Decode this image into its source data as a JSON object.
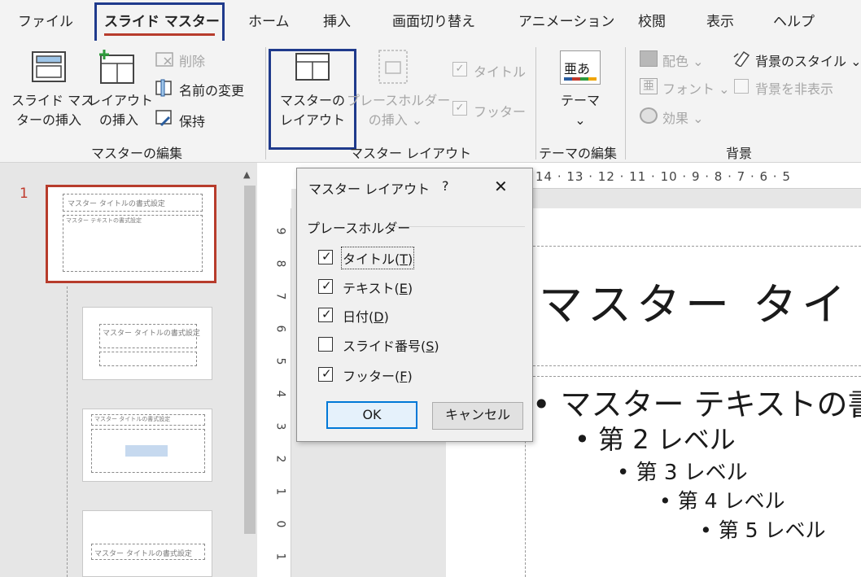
{
  "tabs": [
    {
      "label": "ファイル",
      "active": false
    },
    {
      "label": "スライド マスター",
      "active": true
    },
    {
      "label": "ホーム",
      "active": false
    },
    {
      "label": "挿入",
      "active": false
    },
    {
      "label": "画面切り替え",
      "active": false
    },
    {
      "label": "アニメーション",
      "active": false
    },
    {
      "label": "校閲",
      "active": false
    },
    {
      "label": "表示",
      "active": false
    },
    {
      "label": "ヘルプ",
      "active": false
    }
  ],
  "ribbon": {
    "edit_master": {
      "insert_master_line1": "スライド マス",
      "insert_master_line2": "ターの挿入",
      "insert_layout_line1": "レイアウト",
      "insert_layout_line2": "の挿入",
      "delete": "削除",
      "rename": "名前の変更",
      "preserve": "保持",
      "group_label": "マスターの編集"
    },
    "master_layout": {
      "master_layout_line1": "マスターの",
      "master_layout_line2": "レイアウト",
      "insert_placeholder_line1": "プレースホルダー",
      "insert_placeholder_line2": "の挿入",
      "title_check": "タイトル",
      "footer_check": "フッター",
      "group_label": "マスター レイアウト"
    },
    "edit_theme": {
      "theme": "テーマ",
      "theme_icon_text": "亜あ",
      "group_label": "テーマの編集"
    },
    "background": {
      "colors": "配色",
      "fonts": "フォント",
      "effects": "効果",
      "bg_styles": "背景のスタイル",
      "hide_bg": "背景を非表示",
      "group_label": "背景"
    }
  },
  "slides_pane": {
    "slide_number": "1",
    "thumb1_title": "マスター タイトルの書式設定",
    "thumb1_body": "マスター テキストの書式設定",
    "thumb2_title": "マスター タイトルの書式設定",
    "thumb3_title": "マスター タイトルの書式設定",
    "thumb4_title": "マスター タイトルの書式設定"
  },
  "ruler": {
    "h_ticks": "14 · 13 · 12 · 11 · 10 · 9 · 8 · 7 · 6 · 5",
    "v_ticks": [
      "9",
      "8",
      "7",
      "6",
      "5",
      "4",
      "3",
      "2",
      "1",
      "0",
      "1"
    ]
  },
  "slide": {
    "title": "マスター タイ",
    "level1": "マスター テキストの書",
    "level2": "第 2 レベル",
    "level3": "第 3 レベル",
    "level4": "第 4 レベル",
    "level5": "第 5 レベル"
  },
  "dialog": {
    "title": "マスター レイアウト",
    "help": "?",
    "group": "プレースホルダー",
    "options": [
      {
        "label": "タイトル(",
        "key": "T",
        "end": ")",
        "checked": true
      },
      {
        "label": "テキスト(",
        "key": "E",
        "end": ")",
        "checked": true
      },
      {
        "label": "日付(",
        "key": "D",
        "end": ")",
        "checked": true
      },
      {
        "label": "スライド番号(",
        "key": "S",
        "end": ")",
        "checked": false
      },
      {
        "label": "フッター(",
        "key": "F",
        "end": ")",
        "checked": true
      }
    ],
    "ok": "OK",
    "cancel": "キャンセル"
  },
  "colors": {
    "accent_red": "#b73c2c",
    "highlight_blue": "#1f3a8c",
    "focus_blue": "#0078d7"
  }
}
